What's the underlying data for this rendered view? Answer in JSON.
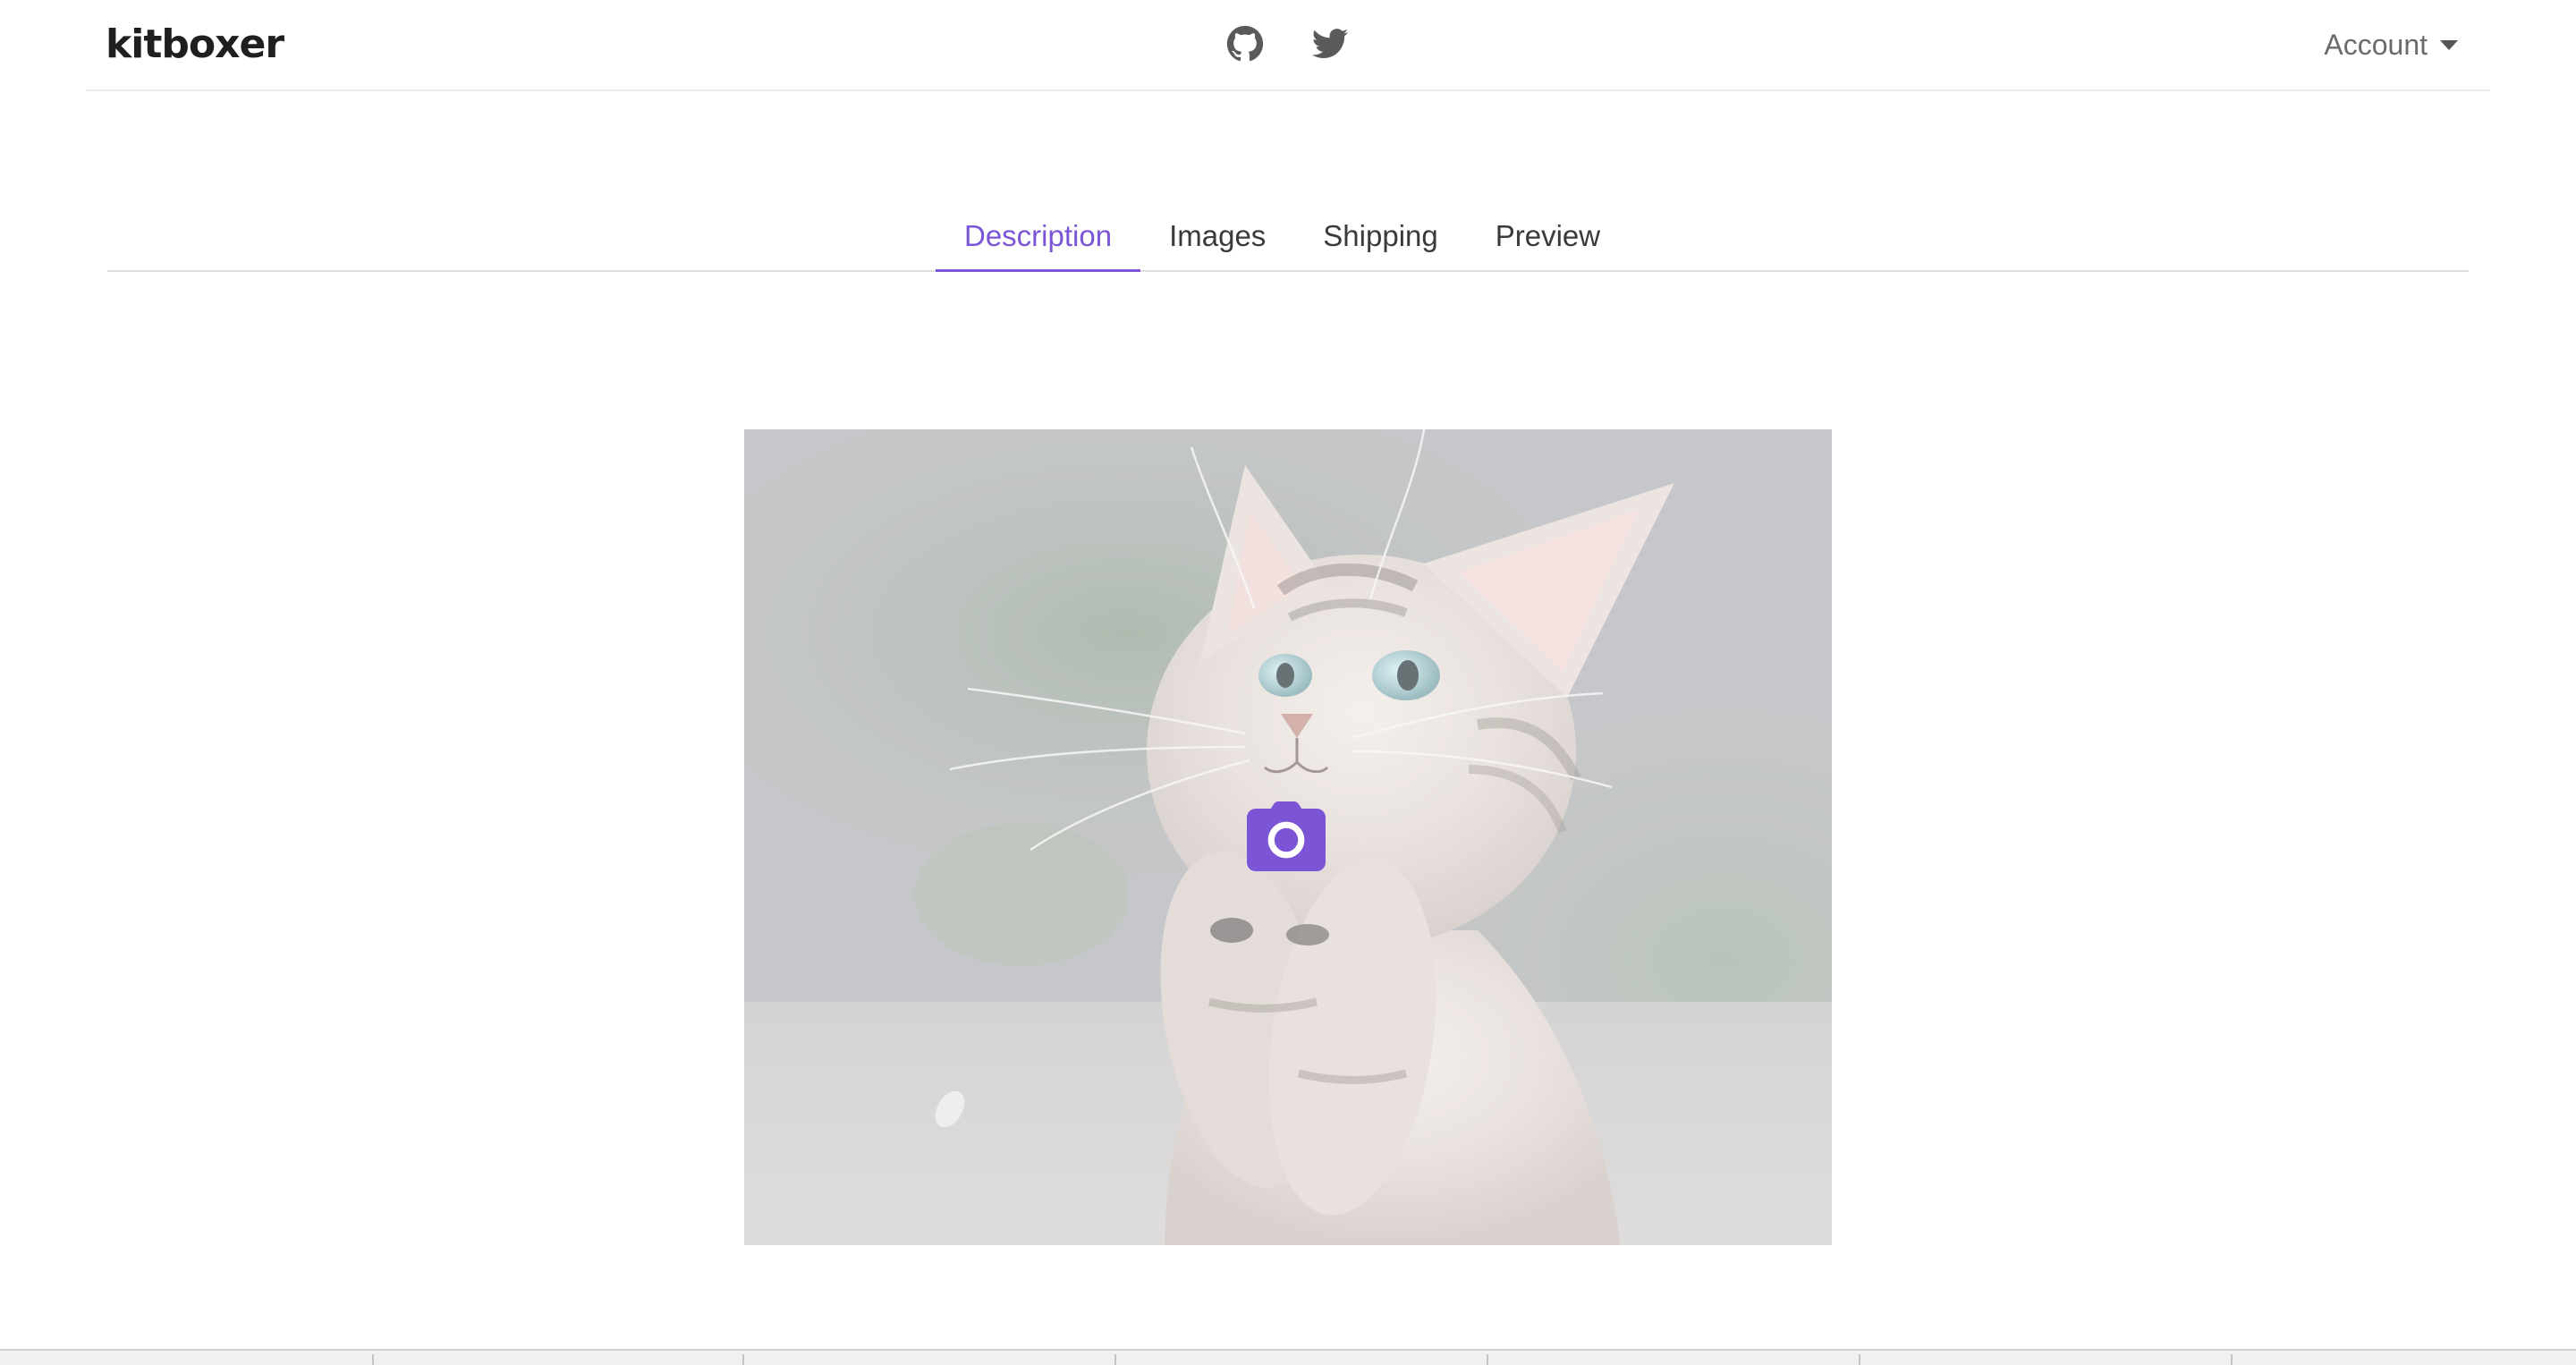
{
  "navbar": {
    "brand": "kitboxer",
    "social": [
      {
        "icon": "github-icon"
      },
      {
        "icon": "twitter-icon"
      }
    ],
    "account_label": "Account"
  },
  "tabs": [
    {
      "label": "Description",
      "active": true
    },
    {
      "label": "Images",
      "active": false
    },
    {
      "label": "Shipping",
      "active": false
    },
    {
      "label": "Preview",
      "active": false
    }
  ],
  "image_upload": {
    "image_subject": "kitten photo",
    "overlay_icon": "camera-icon"
  },
  "colors": {
    "accent": "#7c55d6",
    "text": "#3a3a3a",
    "brand_text": "#1f1f1f",
    "muted": "#6b6b6b",
    "divider": "#e0e0e0"
  }
}
